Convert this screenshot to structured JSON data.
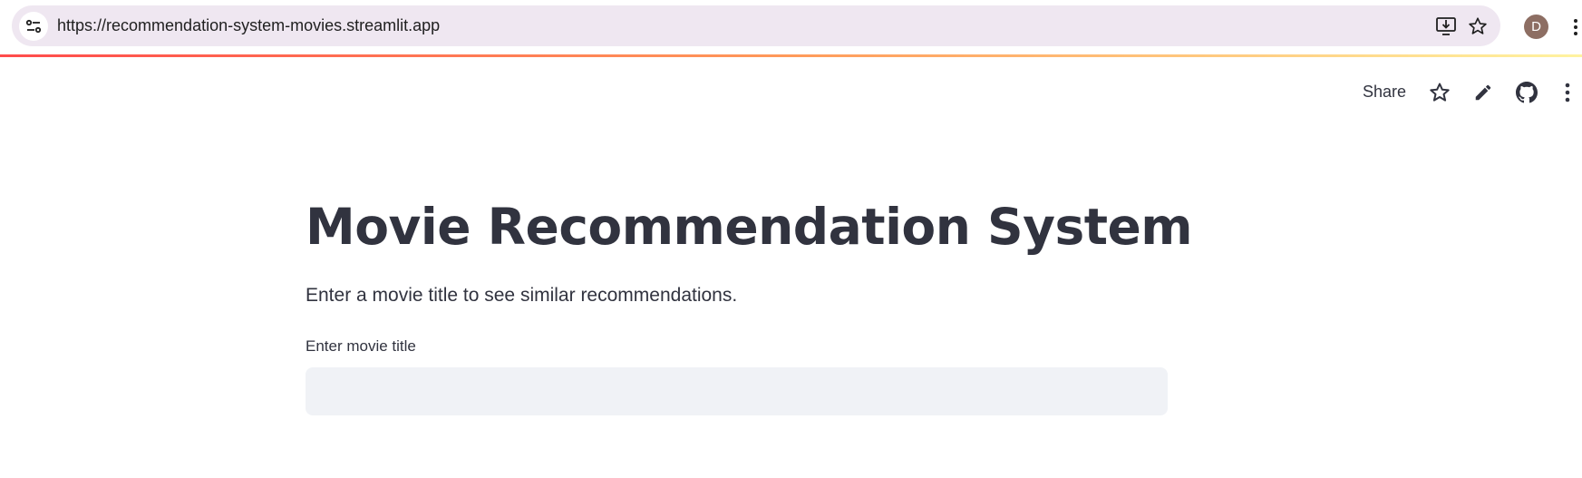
{
  "browser": {
    "url": "https://recommendation-system-movies.streamlit.app",
    "avatar_letter": "D",
    "icons": [
      "site-info-icon",
      "install-app-icon",
      "bookmark-star-icon",
      "browser-menu-icon"
    ]
  },
  "toolbar": {
    "share_label": "Share",
    "icons": [
      "star-icon",
      "edit-icon",
      "github-icon",
      "more-vert-icon"
    ]
  },
  "main": {
    "title": "Movie Recommendation System",
    "subtitle": "Enter a movie title to see similar recommendations.",
    "input_label": "Enter movie title",
    "input_value": "",
    "input_placeholder": ""
  },
  "colors": {
    "text": "#31333f",
    "input_bg": "#f0f2f6",
    "omnibox_bg": "#efe7f1",
    "decoration_start": "#ff4b4b",
    "decoration_end": "#fff3a0",
    "avatar_bg": "#8d6e63"
  }
}
